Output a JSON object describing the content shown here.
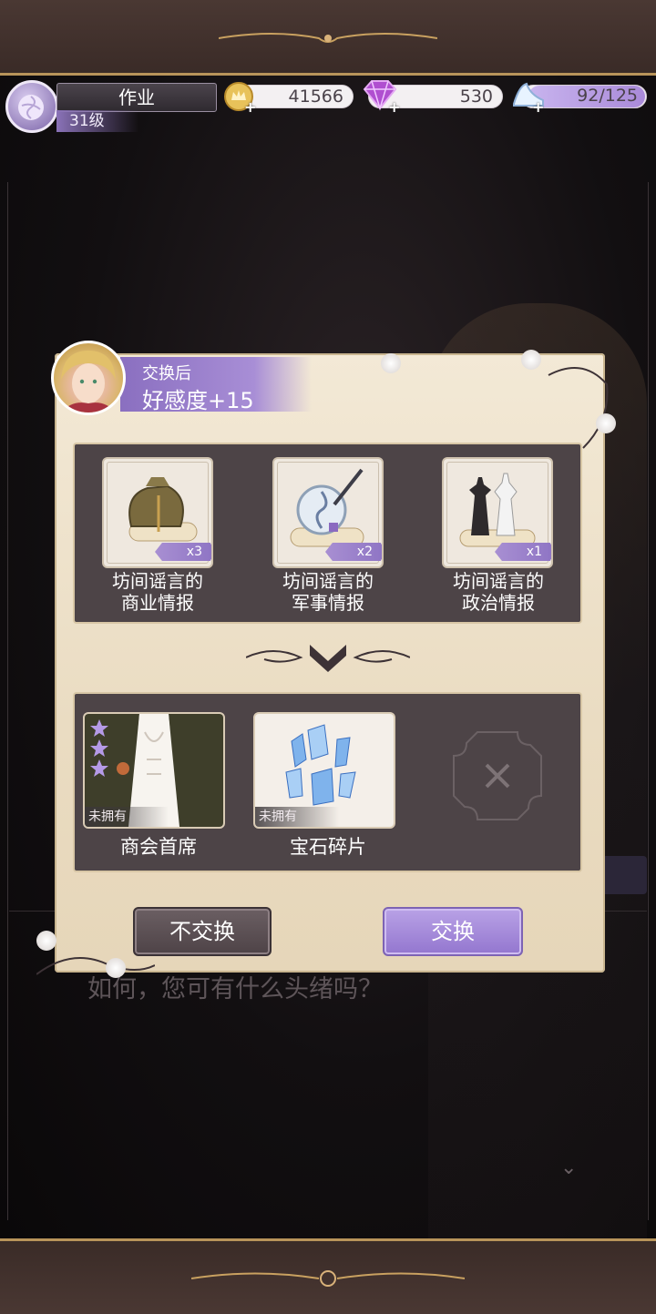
{
  "hud": {
    "player_name": "作业",
    "level": "31级",
    "gold": "41566",
    "diamonds": "530",
    "stamina": "92/125"
  },
  "exchange": {
    "affinity_title": "交换后",
    "affinity_value": "好感度+15",
    "cost_items": [
      {
        "label_line1": "坊间谣言的",
        "label_line2": "商业情报",
        "qty": "x3",
        "icon": "money-bag-scroll-icon"
      },
      {
        "label_line1": "坊间谣言的",
        "label_line2": "军事情报",
        "qty": "x2",
        "icon": "shield-sword-scroll-icon"
      },
      {
        "label_line1": "坊间谣言的",
        "label_line2": "政治情报",
        "qty": "x1",
        "icon": "chess-pieces-scroll-icon"
      }
    ],
    "rewards": [
      {
        "label": "商会首席",
        "tag": "未拥有",
        "icon": "jacket-outfit-icon"
      },
      {
        "label": "宝石碎片",
        "tag": "未拥有",
        "icon": "gem-shards-icon"
      }
    ],
    "decline_label": "不交换",
    "confirm_label": "交换"
  },
  "scene": {
    "dialog_text": "如何，您可有什么头绪吗？"
  }
}
